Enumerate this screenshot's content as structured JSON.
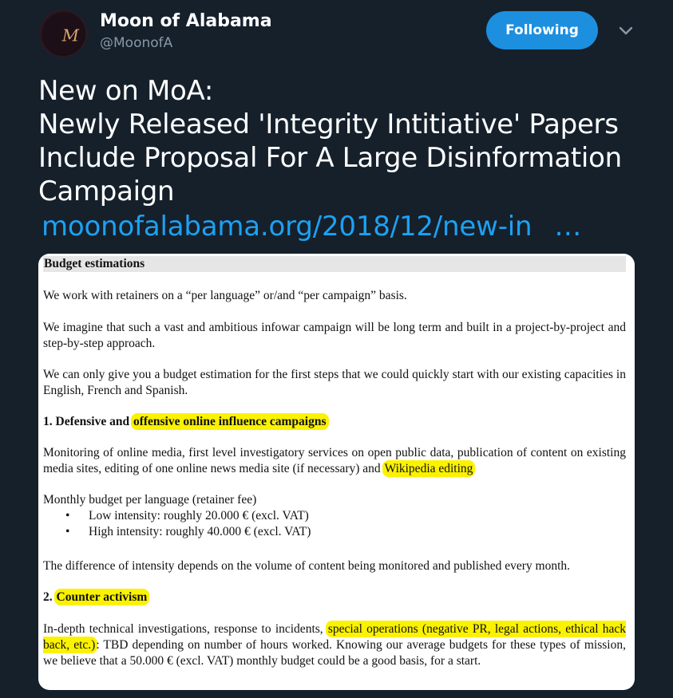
{
  "account": {
    "display_name": "Moon of Alabama",
    "handle": "@MoonofA",
    "avatar_letter": "M",
    "follow_label": "Following",
    "accent_color": "#1d8fdf"
  },
  "tweet": {
    "lines": [
      "New on MoA:",
      "Newly Released 'Integrity Intitiative' Papers",
      "Include Proposal For A Large Disinformation",
      "Campaign"
    ],
    "link_text": "moonofalabama.org/2018/12/new-in",
    "link_ellipsis": "…"
  },
  "document": {
    "heading": "Budget estimations",
    "para1": "We work with retainers on a “per language” or/and “per campaign” basis.",
    "para2": "We imagine that such a vast and ambitious infowar campaign will be long term and built in a project-by-project and step-by-step approach.",
    "para3": "We can only give you a budget estimation for the first steps that we could quickly start with our existing capacities in English, French and Spanish.",
    "section1_prefix": "1. Defensive and",
    "section1_highlight": "offensive online influence campaigns",
    "para4_text": "Monitoring of online media, first level investigatory services on open public data, publication of content on existing media sites, editing of one online news media site (if necessary) and",
    "para4_highlight": "Wikipedia editing",
    "budget_label": "Monthly budget per language (retainer fee)",
    "bullets": [
      "Low intensity: roughly 20.000 € (excl. VAT)",
      "High intensity: roughly 40.000 € (excl. VAT)"
    ],
    "para5": "The difference of intensity depends on the volume of content being monitored and published every month.",
    "section2_prefix": "2.",
    "section2_highlight": "Counter activism",
    "para6_prefix": "In-depth technical investigations, response to incidents,",
    "para6_highlight": "special operations (negative PR, legal actions, ethical hack back, etc.)",
    "para6_suffix": ": TBD depending on number of hours worked. Knowing our average budgets for these types of mission, we believe that a 50.000 € (excl. VAT) monthly budget could be a good basis, for a start.",
    "highlight_color": "#fbf200"
  }
}
